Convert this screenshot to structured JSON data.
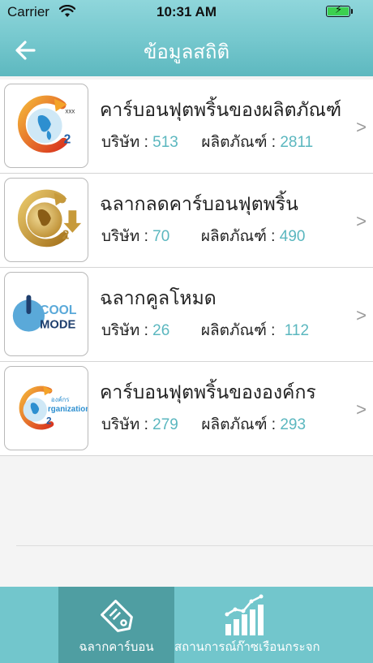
{
  "status_bar": {
    "carrier": "Carrier",
    "time": "10:31 AM"
  },
  "header": {
    "title": "ข้อมูลสถิติ"
  },
  "stat_labels": {
    "company": "บริษัท :",
    "product": "ผลิตภัณฑ์ :"
  },
  "rows": [
    {
      "title": "คาร์บอนฟุตพริ้นของผลิตภัณฑ์",
      "company": "513",
      "product": "2811",
      "icon": "carbon-footprint-product-logo",
      "chevron": ">"
    },
    {
      "title": "ฉลากลดคาร์บอนฟุตพริ้น",
      "company": "70",
      "product": "490",
      "icon": "carbon-reduction-label-logo",
      "chevron": ">"
    },
    {
      "title": "ฉลากคูลโหมด",
      "company": "26",
      "product": "112",
      "icon": "cool-mode-logo",
      "chevron": ">"
    },
    {
      "title": "คาร์บอนฟุตพริ้นขององค์กร",
      "company": "279",
      "product": "293",
      "icon": "carbon-footprint-organization-logo",
      "chevron": ">"
    }
  ],
  "logo_text": {
    "xxx": "xxx",
    "co2_sub": "2",
    "cool": "COOL",
    "mode": "MODE",
    "org_th": "องค์กร",
    "org_en": "rganization"
  },
  "tabs": [
    {
      "label": "ฉลากคาร์บอน",
      "icon": "tag-icon",
      "active": true
    },
    {
      "label": "สถานการณ์ก๊าซเรือนกระจก",
      "icon": "bar-chart-icon",
      "active": false
    }
  ],
  "colors": {
    "accent": "#72c6cc",
    "accent_dark": "#4f9ea2",
    "value": "#5bb7bf"
  }
}
